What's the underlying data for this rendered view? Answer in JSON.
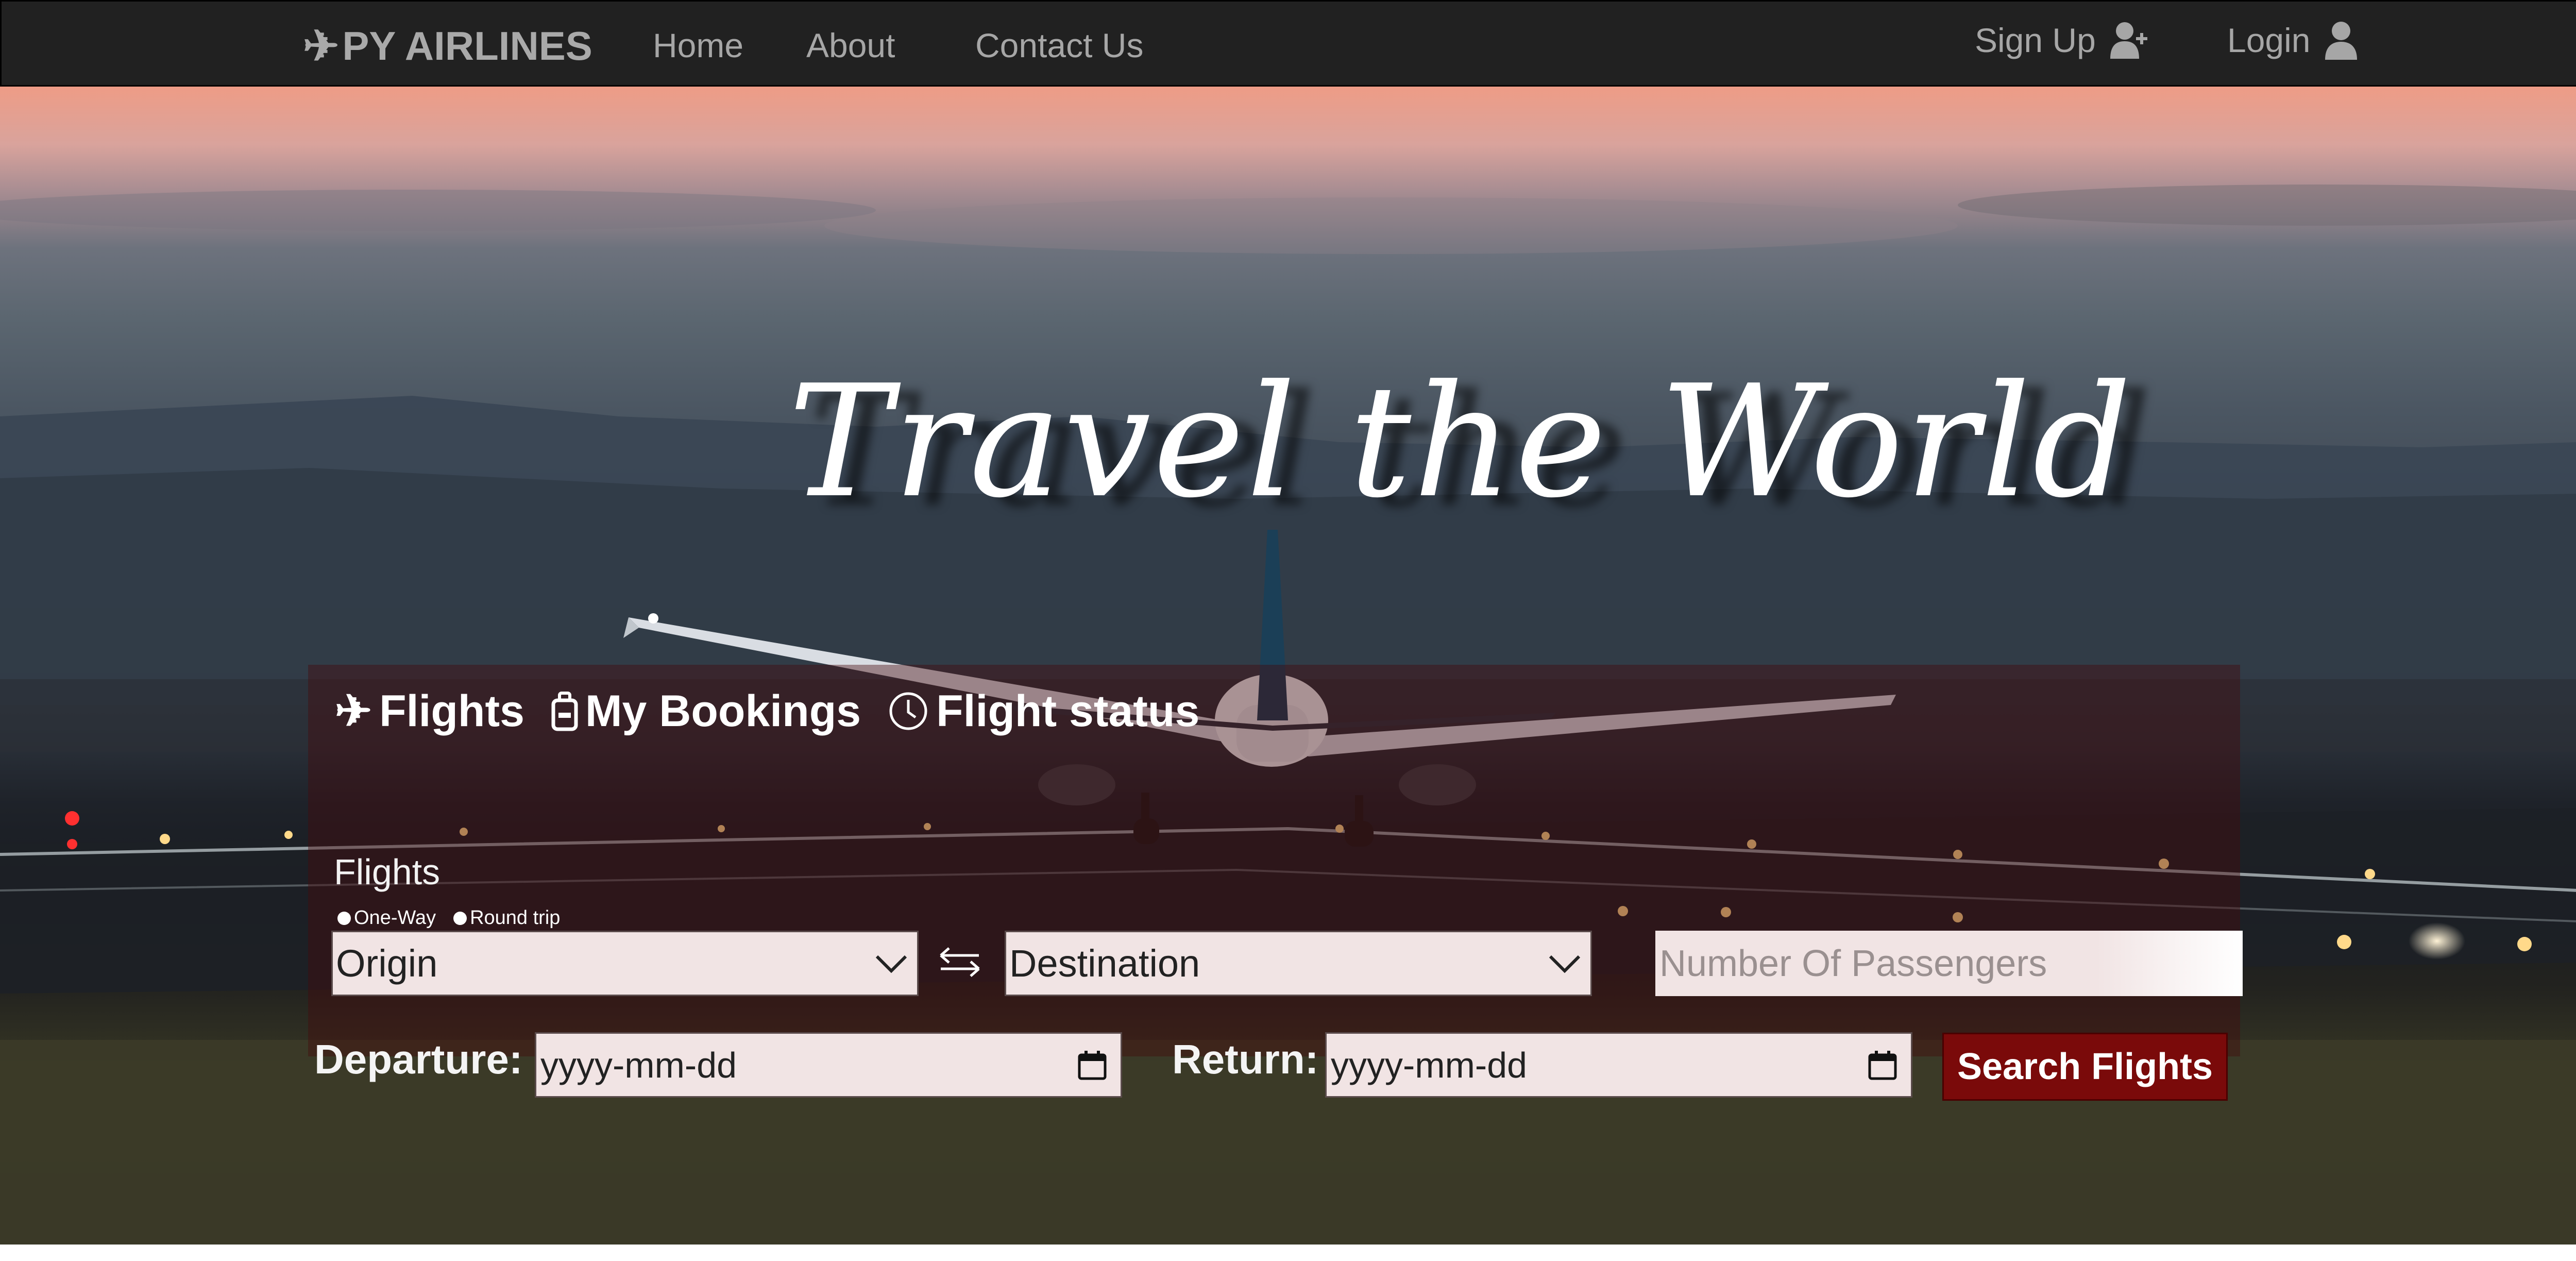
{
  "colors": {
    "navbar_bg": "#212121",
    "nav_text": "#a6a6a6",
    "panel_bg": "rgba(70,10,12,0.42)",
    "field_bg": "#f1e4e4",
    "button_bg": "#7a0a0a",
    "button_text": "#ffffff"
  },
  "navbar": {
    "brand": "PY AIRLINES",
    "brand_icon": "airplane-icon",
    "links": {
      "home": "Home",
      "about": "About",
      "contact": "Contact Us"
    },
    "signup": {
      "label": "Sign Up",
      "icon": "user-plus-icon"
    },
    "login": {
      "label": "Login",
      "icon": "user-icon"
    }
  },
  "hero": {
    "title": "Travel the World"
  },
  "booking": {
    "tabs": {
      "flights": {
        "label": "Flights",
        "icon": "airplane-icon"
      },
      "bookings": {
        "label": "My Bookings",
        "icon": "luggage-icon"
      },
      "status": {
        "label": "Flight status",
        "icon": "clock-icon"
      }
    },
    "section_label": "Flights",
    "trip_types": {
      "one_way": "One-Way",
      "round_trip": "Round trip"
    },
    "origin": {
      "value": "Origin",
      "icon": "chevron-down-icon"
    },
    "swap_icon": "swap-arrows-icon",
    "destination": {
      "value": "Destination",
      "icon": "chevron-down-icon"
    },
    "passengers": {
      "placeholder": "Number Of Passengers"
    },
    "departure": {
      "label": "Departure:",
      "value": "yyyy-mm-dd",
      "icon": "calendar-icon"
    },
    "return": {
      "label": "Return:",
      "value": "yyyy-mm-dd",
      "icon": "calendar-icon"
    },
    "search_button": "Search Flights"
  }
}
